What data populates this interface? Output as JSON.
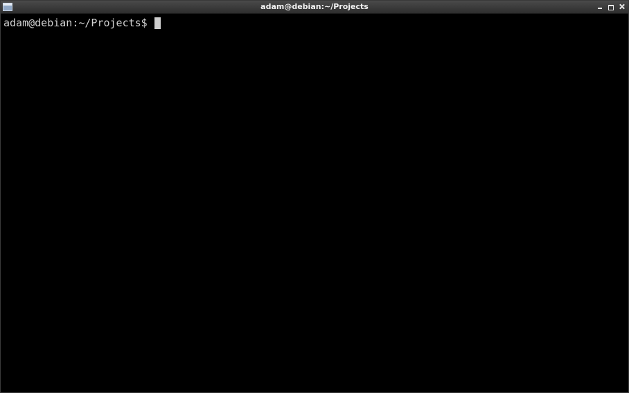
{
  "window": {
    "title": "adam@debian:~/Projects"
  },
  "terminal": {
    "prompt": "adam@debian:~/Projects$ "
  }
}
